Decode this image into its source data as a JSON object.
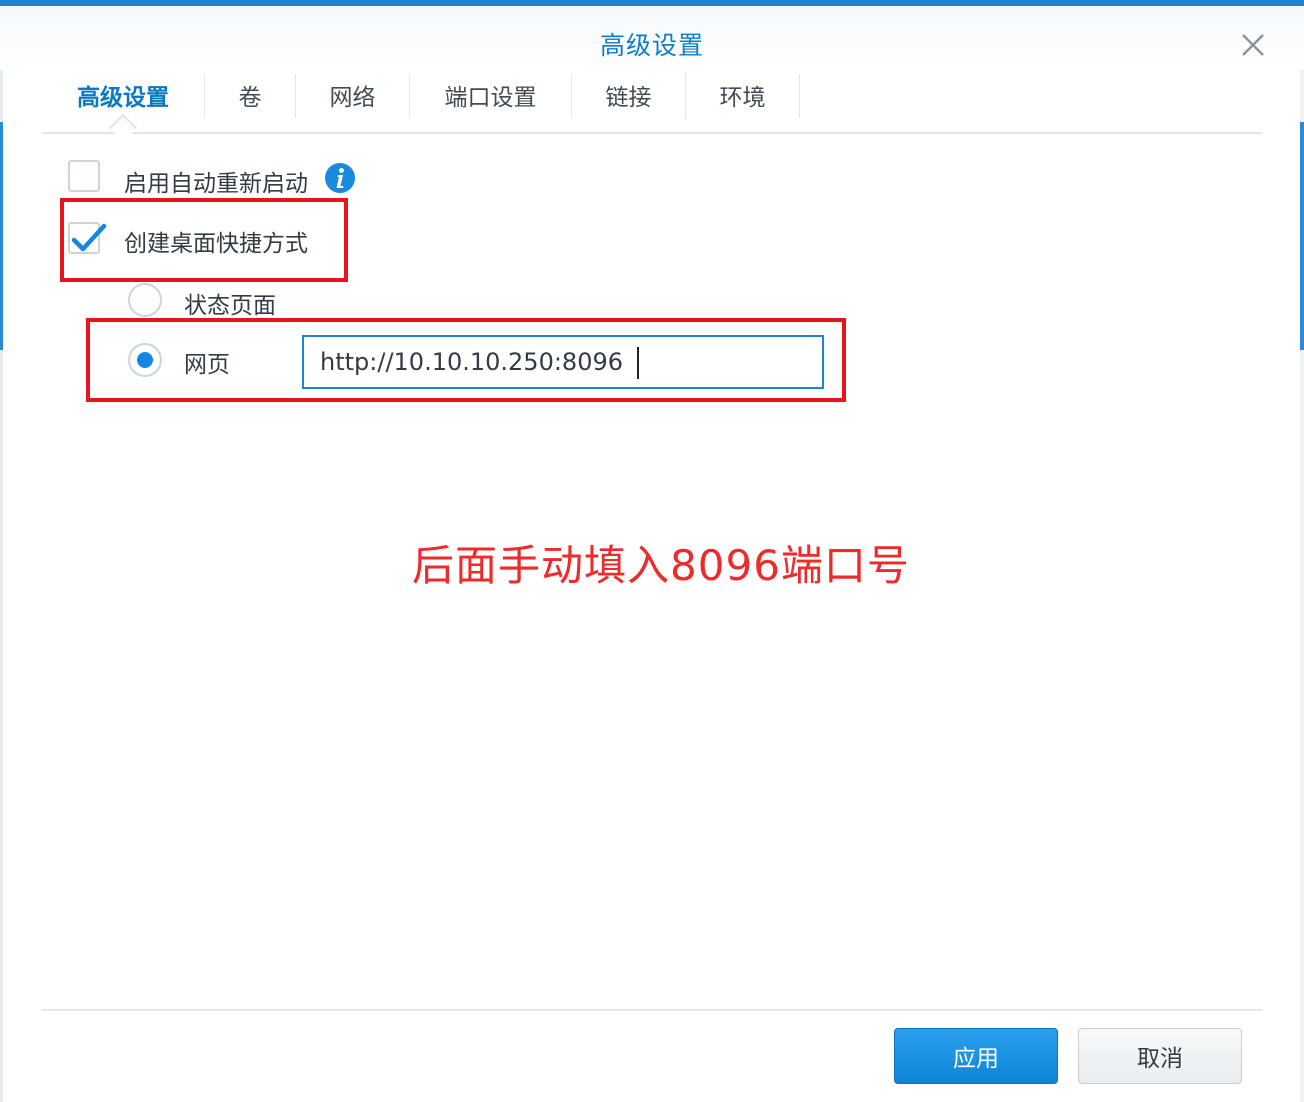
{
  "dialog": {
    "title": "高级设置"
  },
  "tabs": [
    {
      "label": "高级设置",
      "active": true
    },
    {
      "label": "卷",
      "active": false
    },
    {
      "label": "网络",
      "active": false
    },
    {
      "label": "端口设置",
      "active": false
    },
    {
      "label": "链接",
      "active": false
    },
    {
      "label": "环境",
      "active": false
    }
  ],
  "form": {
    "auto_restart": {
      "label": "启用自动重新启动",
      "checked": false
    },
    "desktop_shortcut": {
      "label": "创建桌面快捷方式",
      "checked": true
    },
    "shortcut_options": [
      {
        "label": "状态页面",
        "selected": false
      },
      {
        "label": "网页",
        "selected": true
      }
    ],
    "url_value": "http://10.10.10.250:8096"
  },
  "annotation": "后面手动填入8096端口号",
  "footer": {
    "apply_label": "应用",
    "cancel_label": "取消"
  },
  "colors": {
    "accent": "#0b7ec9",
    "annotation_red": "#e8141c"
  }
}
